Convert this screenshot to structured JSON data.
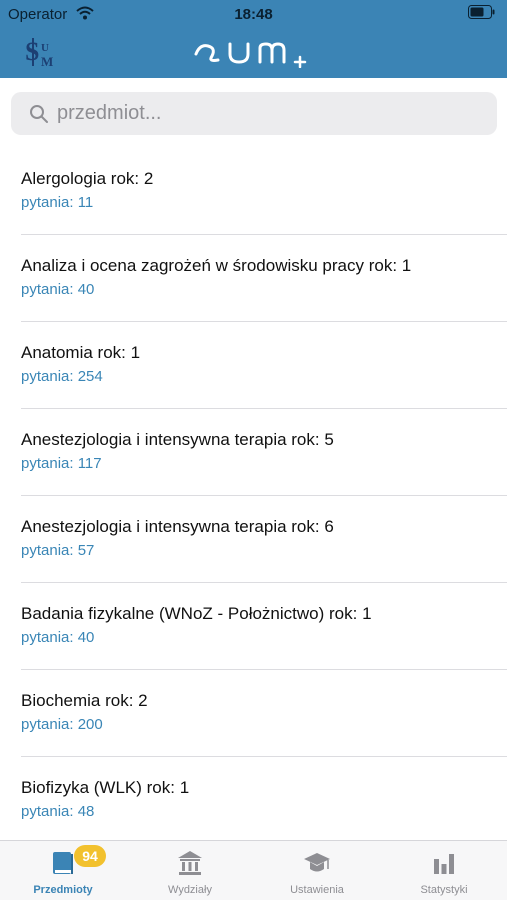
{
  "status": {
    "carrier": "Operator",
    "time": "18:48"
  },
  "header": {
    "logo_left": "SUM crest logo",
    "logo_center": "SUM+ logo"
  },
  "search": {
    "placeholder": "przedmiot..."
  },
  "items": [
    {
      "title": "Alergologia rok: 2",
      "sub": "pytania: 11"
    },
    {
      "title": "Analiza i ocena zagrożeń w środowisku pracy rok: 1",
      "sub": "pytania: 40"
    },
    {
      "title": "Anatomia rok: 1",
      "sub": "pytania: 254"
    },
    {
      "title": "Anestezjologia i intensywna terapia rok: 5",
      "sub": "pytania: 117"
    },
    {
      "title": "Anestezjologia i intensywna terapia rok: 6",
      "sub": "pytania: 57"
    },
    {
      "title": "Badania fizykalne (WNoZ - Położnictwo) rok: 1",
      "sub": "pytania: 40"
    },
    {
      "title": "Biochemia rok: 2",
      "sub": "pytania: 200"
    },
    {
      "title": "Biofizyka (WLK) rok: 1",
      "sub": "pytania: 48"
    }
  ],
  "tabs": [
    {
      "label": "Przedmioty",
      "icon": "book-icon",
      "active": true,
      "badge": "94"
    },
    {
      "label": "Wydziały",
      "icon": "building-icon"
    },
    {
      "label": "Ustawienia",
      "icon": "graduation-cap-icon"
    },
    {
      "label": "Statystyki",
      "icon": "bar-chart-icon"
    }
  ],
  "colors": {
    "accent": "#3b84b5",
    "badge": "#f2c12e",
    "subtitle": "#3a86b6"
  }
}
